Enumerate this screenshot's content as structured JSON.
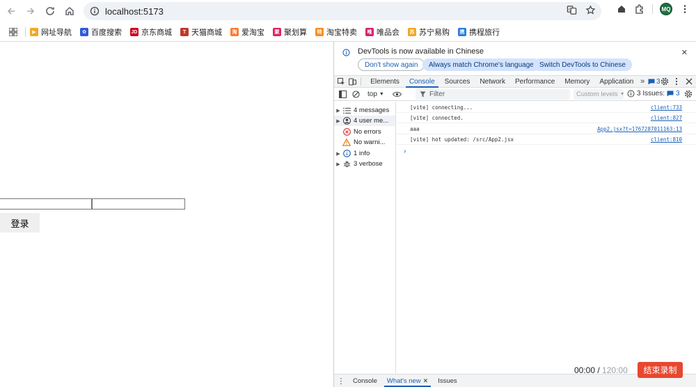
{
  "browser": {
    "url": "localhost:5173",
    "profile_initials": "MQ"
  },
  "bookmarks": [
    {
      "label": "网址导航",
      "color": "#f5a623",
      "glyph": "▶"
    },
    {
      "label": "百度搜索",
      "color": "#2f5bd6",
      "glyph": "✿"
    },
    {
      "label": "京东商城",
      "color": "#d0021b",
      "glyph": "JD"
    },
    {
      "label": "天猫商城",
      "color": "#c0392b",
      "glyph": "T"
    },
    {
      "label": "爱淘宝",
      "color": "#ff7a2e",
      "glyph": "淘"
    },
    {
      "label": "聚划算",
      "color": "#e0245e",
      "glyph": "聚"
    },
    {
      "label": "淘宝特卖",
      "color": "#ff8c1a",
      "glyph": "特"
    },
    {
      "label": "唯品会",
      "color": "#d6246e",
      "glyph": "唯"
    },
    {
      "label": "苏宁易购",
      "color": "#f5a623",
      "glyph": "苏"
    },
    {
      "label": "携程旅行",
      "color": "#2a7de1",
      "glyph": "携"
    }
  ],
  "page": {
    "login_label": "登录"
  },
  "devtools": {
    "banner": {
      "message": "DevTools is now available in Chinese",
      "btn_dont_show": "Don't show again",
      "btn_match": "Always match Chrome's language",
      "btn_switch": "Switch DevTools to Chinese"
    },
    "tabs": [
      "Elements",
      "Console",
      "Sources",
      "Network",
      "Performance",
      "Memory",
      "Application"
    ],
    "issue_count": "3",
    "toolbar": {
      "context": "top",
      "filter_placeholder": "Filter",
      "levels": "Custom levels",
      "issues_label": "3 Issues:",
      "issues_count": "3"
    },
    "sidebar": [
      {
        "label": "4 messages",
        "icon": "list-icon",
        "expandable": true
      },
      {
        "label": "4 user me...",
        "icon": "user-icon",
        "expandable": true
      },
      {
        "label": "No errors",
        "icon": "error-icon",
        "expandable": false
      },
      {
        "label": "No warni...",
        "icon": "warning-icon",
        "expandable": false
      },
      {
        "label": "1 info",
        "icon": "info-icon",
        "expandable": true
      },
      {
        "label": "3 verbose",
        "icon": "bug-icon",
        "expandable": true
      }
    ],
    "logs": [
      {
        "text": "[vite] connecting...",
        "source": "client:733"
      },
      {
        "text": "[vite] connected.",
        "source": "client:827"
      },
      {
        "text": "aaa",
        "source": "App2.jsx?t=1767287011163:13"
      },
      {
        "text": "[vite] hot updated: /src/App2.jsx",
        "source": "client:810"
      }
    ],
    "drawer_tabs": [
      "Console",
      "What's new",
      "Issues"
    ]
  },
  "recorder": {
    "elapsed": "00:00",
    "separator": " / ",
    "total": "120:00",
    "stop_label": "结束录制"
  },
  "colors": {
    "accent": "#1a5fb4",
    "record": "#e8472f",
    "error": "#d93025",
    "warning": "#e37400"
  }
}
